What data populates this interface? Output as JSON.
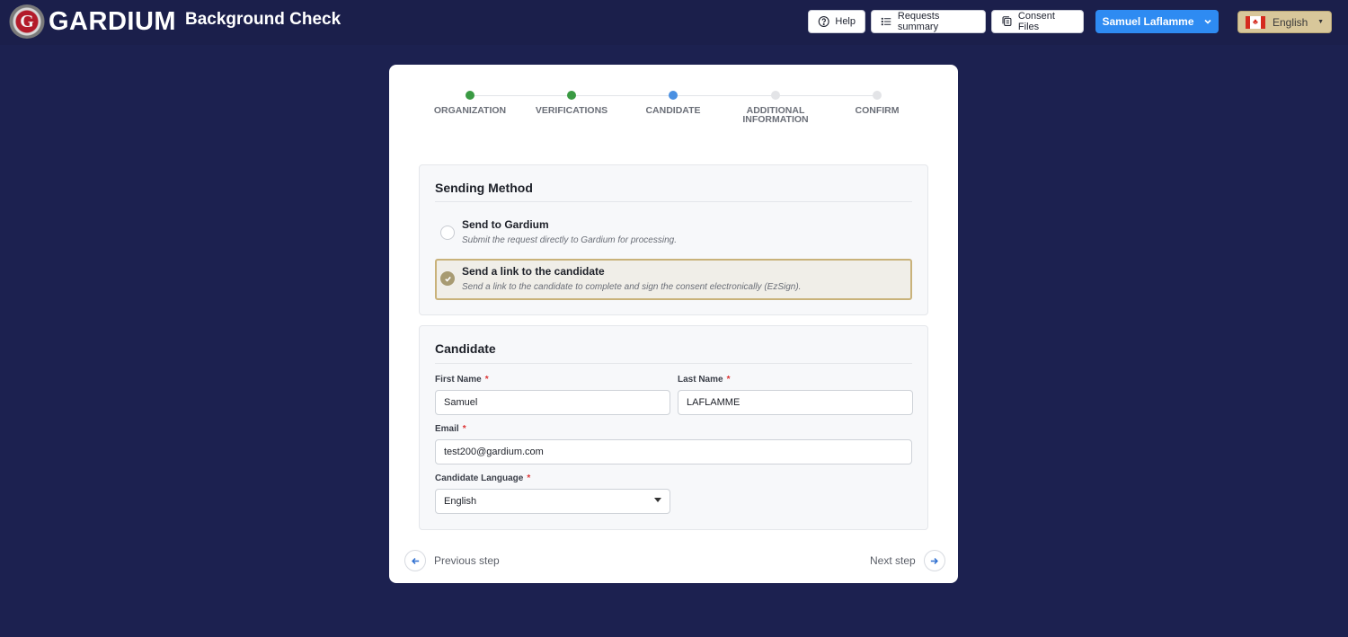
{
  "header": {
    "logo_letter": "G",
    "logo_text": "GARDIUM",
    "app_title": "Background Check",
    "help_label": "Help",
    "requests_label": "Requests summary",
    "consent_label": "Consent Files",
    "user_label": "Samuel Laflamme",
    "language_label": "English"
  },
  "stepper": {
    "steps": [
      {
        "label": "ORGANIZATION",
        "state": "done"
      },
      {
        "label": "VERIFICATIONS",
        "state": "done"
      },
      {
        "label": "CANDIDATE",
        "state": "active"
      },
      {
        "label": "ADDITIONAL INFORMATION",
        "state": "todo"
      },
      {
        "label": "CONFIRM",
        "state": "todo"
      }
    ]
  },
  "sending": {
    "title": "Sending Method",
    "options": [
      {
        "title": "Send to Gardium",
        "subtitle": "Submit the request directly to Gardium for processing.",
        "selected": false
      },
      {
        "title": "Send a link to the candidate",
        "subtitle": "Send a link to the candidate to complete and sign the consent electronically (EzSign).",
        "selected": true
      }
    ]
  },
  "candidate": {
    "title": "Candidate",
    "first_name_label": "First Name",
    "first_name_value": "Samuel",
    "last_name_label": "Last Name",
    "last_name_value": "LAFLAMME",
    "email_label": "Email",
    "email_value": "test200@gardium.com",
    "language_label": "Candidate Language",
    "language_value": "English",
    "required_mark": "*"
  },
  "nav": {
    "previous_label": "Previous step",
    "next_label": "Next step"
  },
  "colors": {
    "background": "#1c2150",
    "user_button": "#2e8bf2",
    "step_done": "#3a9a43",
    "step_active": "#4a90e2",
    "selected_border": "#c9b27a"
  }
}
